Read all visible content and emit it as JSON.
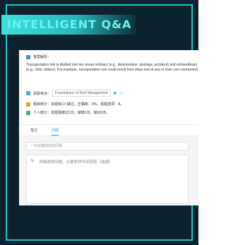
{
  "banner": {
    "text": "INTELLIGENT Q&A"
  },
  "analysis": {
    "label": "答案解析：",
    "text": "Transportation risk is divided into two areas ordinary (e.g., deterioration, spoilage, accident) and extraordinary (e.g., riots, strikes). For example, transportation risk could result from ships lost at sea or train cars overturned."
  },
  "related": {
    "label": "关联考点：",
    "tag": "Foundations of Risk Management"
  },
  "stats": {
    "question_label": "题目统计：",
    "question_value": "本题有2人做过，正确率：0%，易错选项：A。",
    "personal_label": "个人统计：",
    "personal_value": "本题我做过1次，做错1次，做对0次。"
  },
  "tabs": [
    "笔记",
    "问题"
  ],
  "question_input": {
    "placeholder": "一句话描述您的问题"
  },
  "detail": {
    "placeholder": "详细说明问题，以便老师作出回答（选填）"
  },
  "colors": {
    "accent": "#18c7c6",
    "frame": "#0d222d",
    "tab_active": "#1aa3e8",
    "star": "#1aa3e8"
  },
  "icons": [
    "analysis-icon",
    "related-icon",
    "star-icon",
    "question-stats-icon",
    "personal-stats-icon",
    "pen-icon"
  ]
}
